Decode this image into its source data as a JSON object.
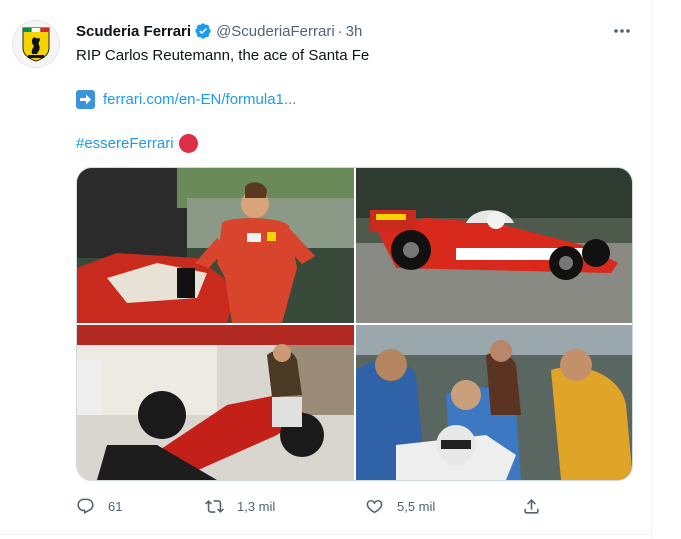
{
  "tweet": {
    "author": {
      "display_name": "Scuderia Ferrari",
      "handle": "@ScuderiaFerrari",
      "separator": "·",
      "time": "3h",
      "avatar_icon": "ferrari-shield-logo",
      "verified_icon": "verified-badge-icon"
    },
    "text": "RIP Carlos Reutemann, the ace of Santa Fe",
    "link": {
      "icon": "right-arrow-emoji",
      "text": "ferrari.com/en-EN/formula1..."
    },
    "hashtag": {
      "text": "#essereFerrari",
      "emoji": "red-circle-emoji"
    },
    "media": [
      {
        "description_icon": "photo-driver-seated-on-car"
      },
      {
        "description_icon": "photo-ferrari-312t-racing"
      },
      {
        "description_icon": "photo-ferrari-f1-garage"
      },
      {
        "description_icon": "photo-pit-crew-around-driver"
      }
    ],
    "actions": {
      "reply_count": "61",
      "retweet_count": "1,3 mil",
      "like_count": "5,5 mil"
    }
  },
  "colors": {
    "accent": "#1d9bf0",
    "text_primary": "#0f1419",
    "text_secondary": "#536471",
    "ferrari_red": "#dd2e44",
    "ferrari_yellow": "#f5d400"
  }
}
